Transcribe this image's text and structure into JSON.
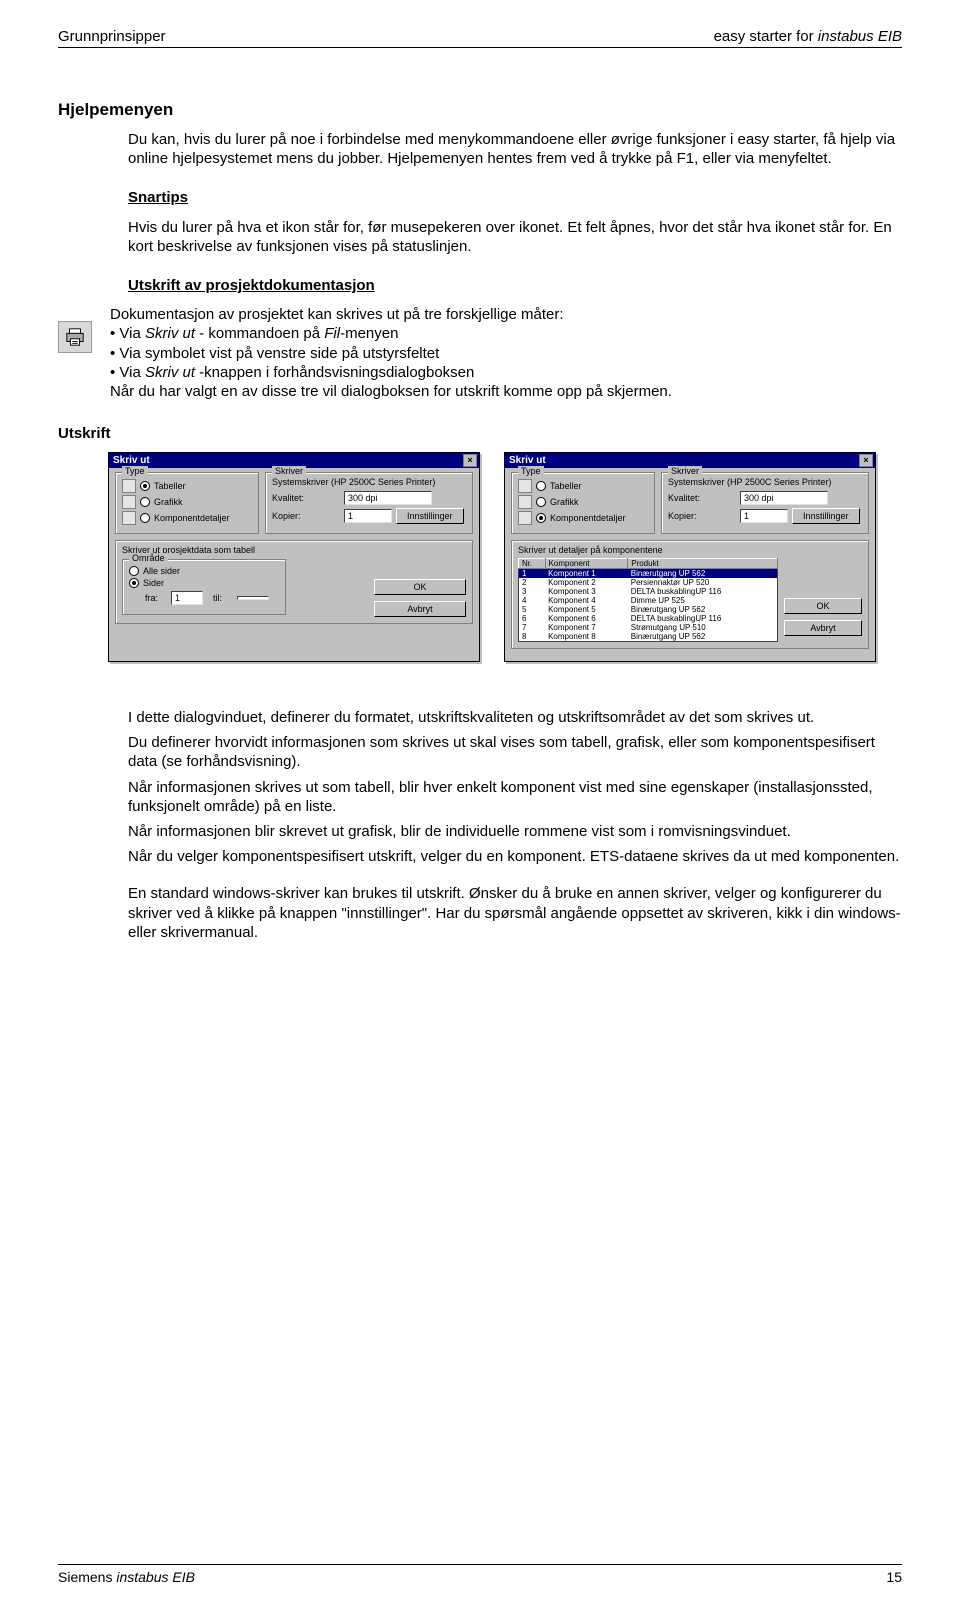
{
  "header": {
    "left": "Grunnprinsipper",
    "right_plain": "easy starter for ",
    "right_italic": "instabus EIB"
  },
  "section_title": "Hjelpemenyen",
  "para1": "Du kan, hvis du lurer på noe i forbindelse med menykommandoene eller øvrige funksjoner i easy starter, få hjelp via online hjelpesystemet mens du jobber. Hjelpemenyen hentes frem ved å trykke på F1, eller via menyfeltet.",
  "sub_snartips": "Snartips",
  "para2": "Hvis du lurer på hva et ikon står for, før musepekeren over ikonet. Et felt åpnes, hvor det står hva ikonet står for. En kort beskrivelse av funksjonen vises på statuslinjen.",
  "sub_utskriftdoc": "Utskrift av prosjektdokumentasjon",
  "doc_intro": "Dokumentasjon av prosjektet kan skrives ut på tre forskjellige måter:",
  "doc_b1a": "Via ",
  "doc_b1b_italic": "Skriv ut",
  "doc_b1c": " - kommandoen på ",
  "doc_b1d_italic": "Fil",
  "doc_b1e": "-menyen",
  "doc_b2": "Via symbolet vist på venstre side på utstyrsfeltet",
  "doc_b3a": "Via ",
  "doc_b3b_italic": "Skriv ut",
  "doc_b3c": " -knappen i forhåndsvisningsdialogboksen",
  "doc_after": "Når du har valgt en av disse tre vil dialogboksen for utskrift komme opp på skjermen.",
  "utskrift_h": "Utskrift",
  "dlg1": {
    "title": "Skriv ut",
    "type_label": "Type",
    "radio_tabeller": "Tabeller",
    "radio_grafikk": "Grafikk",
    "radio_kompdet": "Komponentdetaljer",
    "skriver_label": "Skriver",
    "systemskriver": "Systemskriver (HP 2500C Series Printer)",
    "kvalitet_label": "Kvalitet:",
    "kvalitet_val": "300 dpi",
    "kopier_label": "Kopier:",
    "kopier_val": "1",
    "innst_btn": "Innstillinger",
    "skriver_ut_label": "Skriver ut prosjektdata som tabell",
    "omrade_label": "Område",
    "radio_allesider": "Alle sider",
    "radio_sider": "Sider",
    "fra_label": "fra:",
    "fra_val": "1",
    "til_label": "til:",
    "ok_btn": "OK",
    "avbryt_btn": "Avbryt"
  },
  "dlg2": {
    "title": "Skriv ut",
    "type_label": "Type",
    "radio_tabeller": "Tabeller",
    "radio_grafikk": "Grafikk",
    "radio_kompdet": "Komponentdetaljer",
    "skriver_label": "Skriver",
    "systemskriver": "Systemskriver (HP 2500C Series Printer)",
    "kvalitet_label": "Kvalitet:",
    "kvalitet_val": "300 dpi",
    "kopier_label": "Kopier:",
    "kopier_val": "1",
    "innst_btn": "Innstillinger",
    "detail_label": "Skriver ut detaljer på komponentene",
    "col_nr": "Nr.",
    "col_komp": "Komponent",
    "col_prod": "Produkt",
    "rows": [
      {
        "nr": "1",
        "k": "Komponent 1",
        "p": "Binærutgang UP 562"
      },
      {
        "nr": "2",
        "k": "Komponent 2",
        "p": "Persiennaktør UP 520"
      },
      {
        "nr": "3",
        "k": "Komponent 3",
        "p": "DELTA buskablingUP 116"
      },
      {
        "nr": "4",
        "k": "Komponent 4",
        "p": "Dimme UP 525"
      },
      {
        "nr": "5",
        "k": "Komponent 5",
        "p": "Binærutgang UP 562"
      },
      {
        "nr": "6",
        "k": "Komponent 6",
        "p": "DELTA buskablingUP 116"
      },
      {
        "nr": "7",
        "k": "Komponent 7",
        "p": "Strømutgang UP 510"
      },
      {
        "nr": "8",
        "k": "Komponent 8",
        "p": "Binærutgang UP 562"
      }
    ],
    "ok_btn": "OK",
    "avbryt_btn": "Avbryt"
  },
  "para3": "I dette dialogvinduet, definerer du formatet, utskriftskvaliteten og utskriftsområdet av det som skrives ut.",
  "para4": "Du definerer hvorvidt informasjonen som skrives ut skal vises som tabell, grafisk, eller som komponentspesifisert data (se forhåndsvisning).",
  "para5": "Når informasjonen skrives ut som tabell, blir hver enkelt komponent vist med sine egenskaper (installasjonssted, funksjonelt område) på en liste.",
  "para6": "Når informasjonen blir skrevet ut grafisk, blir de individuelle rommene vist som i romvisningsvinduet.",
  "para7": "Når du velger komponentspesifisert utskrift, velger du en komponent. ETS-dataene skrives da ut med komponenten.",
  "para8": "En standard windows-skriver kan brukes til utskrift. Ønsker du å bruke en annen skriver, velger og konfigurerer du skriver ved å klikke på knappen \"innstillinger\". Har du spørsmål angående oppsettet av skriveren, kikk i din windows- eller skrivermanual.",
  "footer": {
    "left_plain": "Siemens ",
    "left_italic": "instabus EIB",
    "right": "15"
  }
}
